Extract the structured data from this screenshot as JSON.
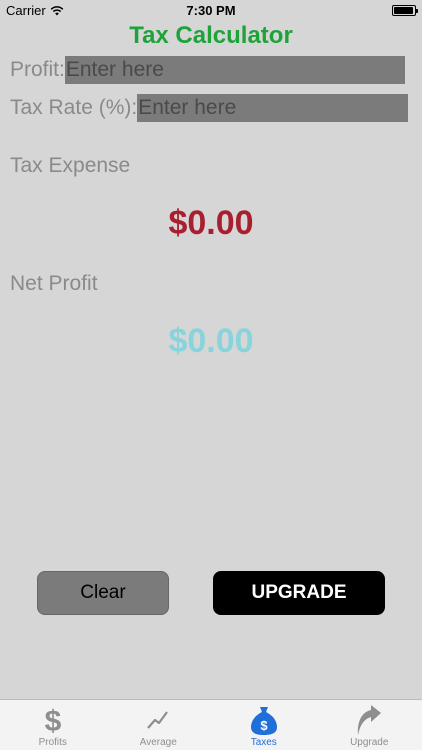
{
  "status_bar": {
    "carrier": "Carrier",
    "time": "7:30 PM",
    "battery_level": 0.95
  },
  "header": {
    "title": "Tax Calculator"
  },
  "form": {
    "profit": {
      "label": "Profit:",
      "placeholder": "Enter here",
      "value": ""
    },
    "tax_rate": {
      "label": "Tax Rate (%):",
      "placeholder": "Enter here",
      "value": ""
    }
  },
  "results": {
    "tax_expense_label": "Tax Expense",
    "tax_expense_value": "$0.00",
    "net_profit_label": "Net Profit",
    "net_profit_value": "$0.00"
  },
  "buttons": {
    "clear_label": "Clear",
    "upgrade_label": "UPGRADE"
  },
  "tab_bar": {
    "active": "Taxes",
    "tabs": [
      {
        "label": "Profits",
        "icon": "dollar-icon"
      },
      {
        "label": "Average",
        "icon": "trend-icon"
      },
      {
        "label": "Taxes",
        "icon": "money-bag-icon"
      },
      {
        "label": "Upgrade",
        "icon": "up-arrow-icon"
      }
    ]
  },
  "colors": {
    "title": "#1ea33a",
    "tax_value": "#a8202f",
    "net_value": "#88d4dc",
    "active_tab": "#1e6fd9",
    "background": "#d6d6d6"
  }
}
